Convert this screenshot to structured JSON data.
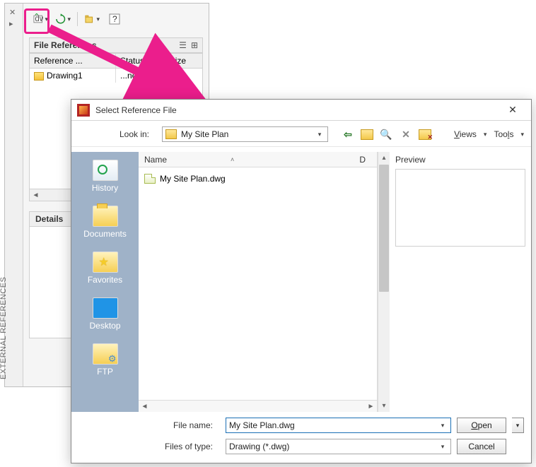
{
  "palette": {
    "title": "EXTERNAL REFERENCES",
    "section_title": "File References",
    "columns": {
      "name": "Reference ...",
      "status": "Status",
      "size": "Size"
    },
    "rows": [
      {
        "name": "Drawing1",
        "status": "...ned",
        "size": ""
      }
    ],
    "details": {
      "label": "Details"
    }
  },
  "dialog": {
    "title": "Select Reference File",
    "lookin_label": "Look in:",
    "lookin_value": "My Site Plan",
    "menus": {
      "views": "Views",
      "tools": "Tools"
    },
    "places": {
      "history": "History",
      "documents": "Documents",
      "favorites": "Favorites",
      "desktop": "Desktop",
      "ftp": "FTP"
    },
    "filelist": {
      "col_name": "Name",
      "col_date": "D",
      "files": [
        {
          "name": "My Site Plan.dwg"
        }
      ]
    },
    "preview_label": "Preview",
    "filename_label": "File name:",
    "filename_value": "My Site Plan.dwg",
    "filetype_label": "Files of type:",
    "filetype_value": "Drawing (*.dwg)",
    "open": "Open",
    "cancel": "Cancel"
  }
}
